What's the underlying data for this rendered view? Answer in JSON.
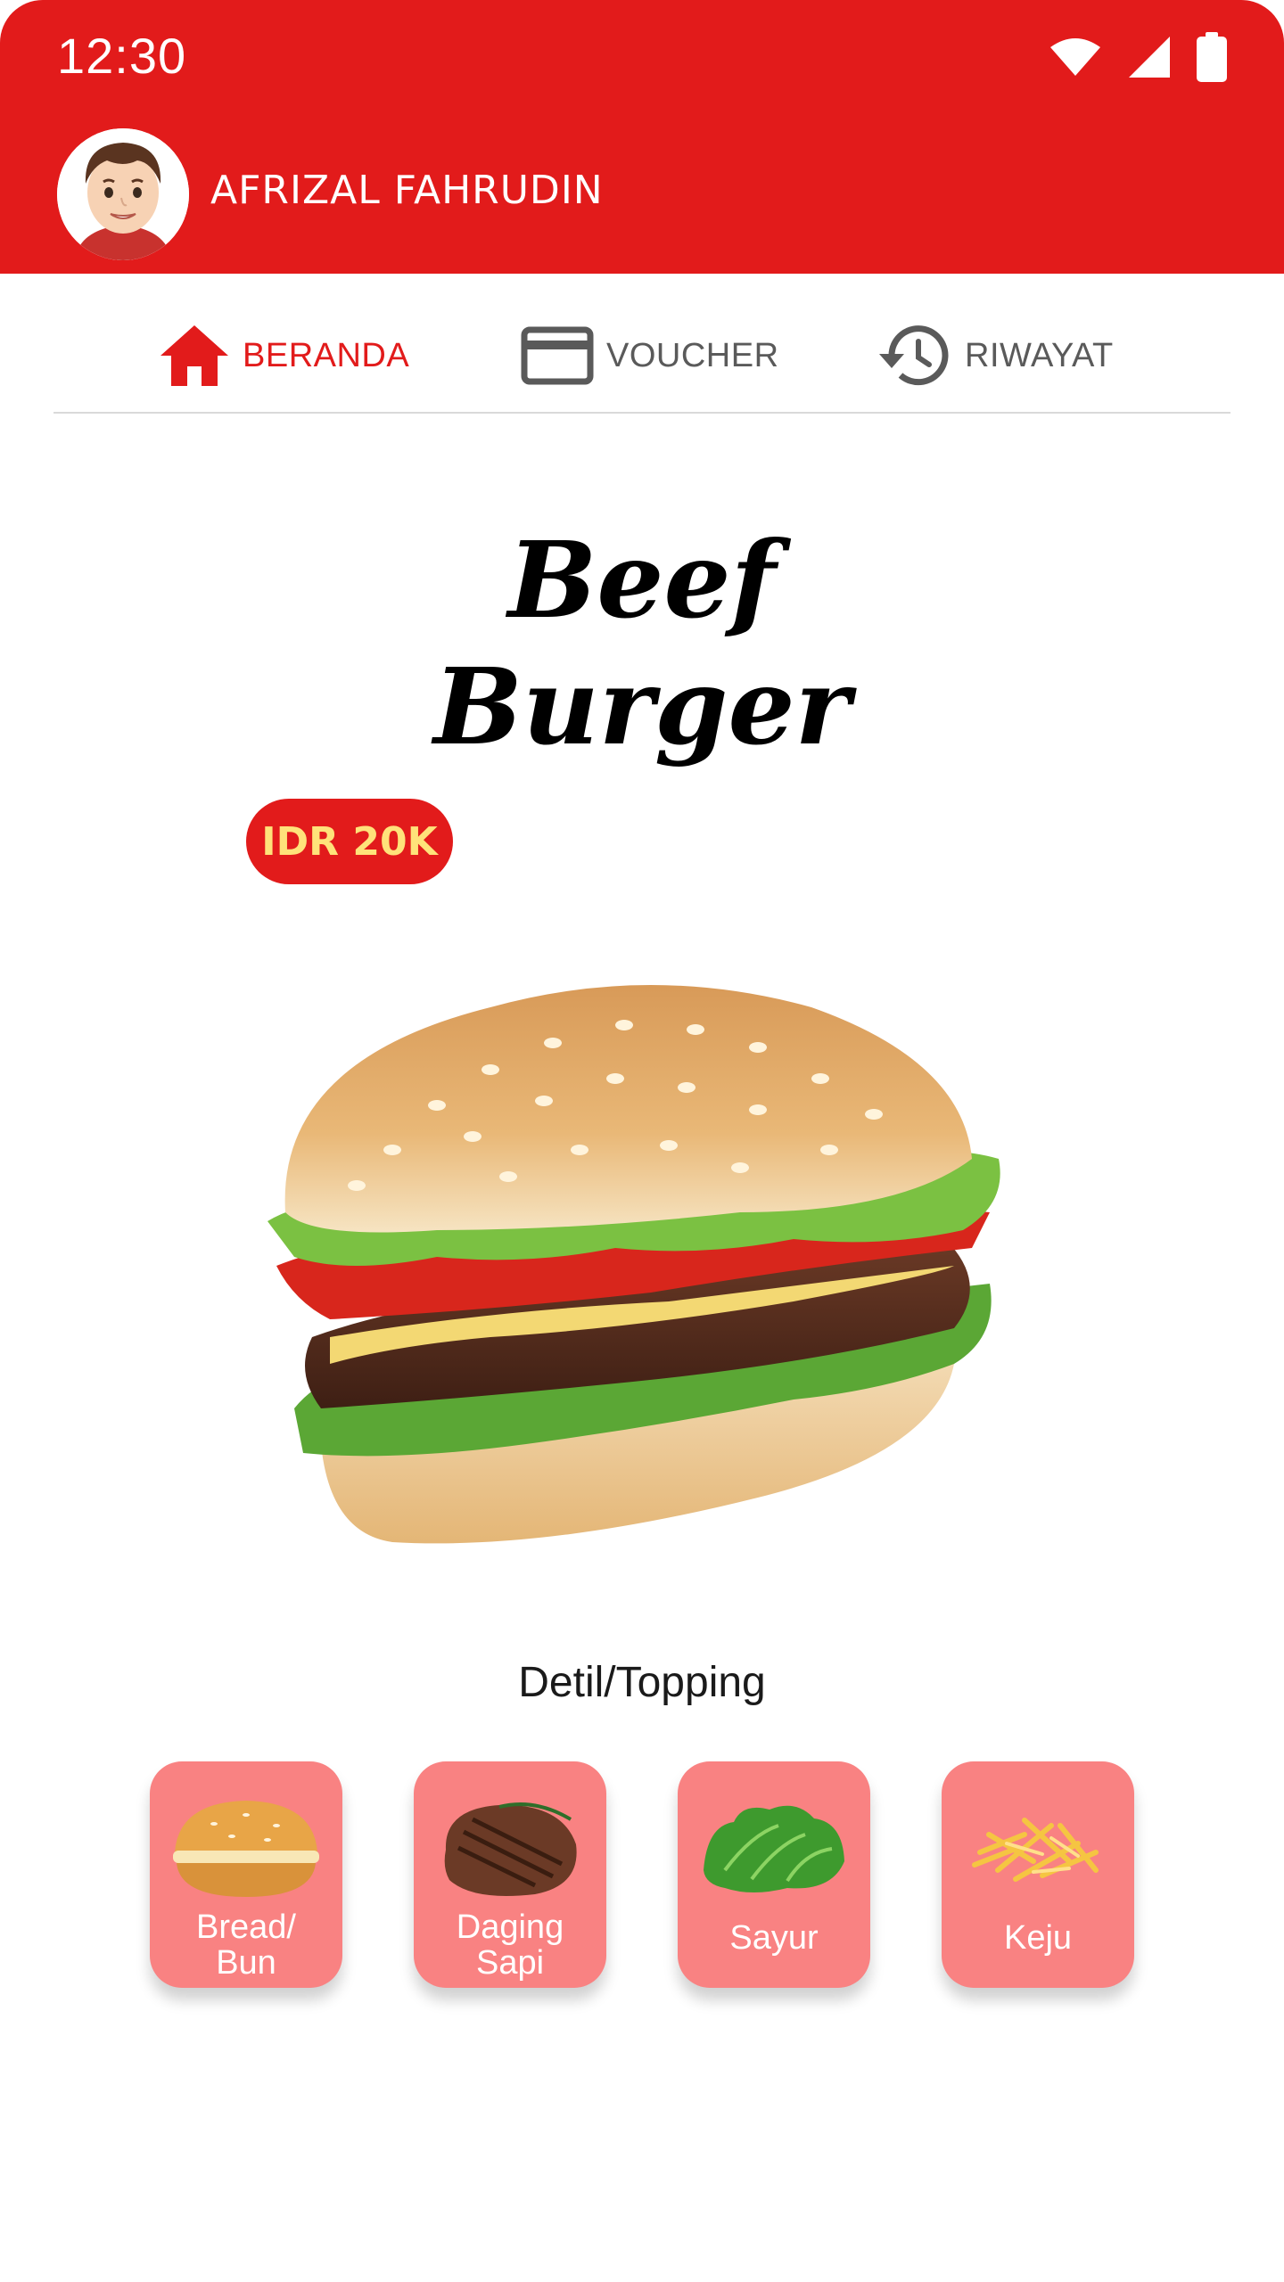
{
  "status_bar": {
    "time": "12:30"
  },
  "user": {
    "name": "AFRIZAL FAHRUDIN"
  },
  "tabs": [
    {
      "label": "BERANDA",
      "icon": "home-icon",
      "active": true
    },
    {
      "label": "VOUCHER",
      "icon": "credit-card-icon",
      "active": false
    },
    {
      "label": "RIWAYAT",
      "icon": "history-icon",
      "active": false
    }
  ],
  "product": {
    "title_line1": "Beef",
    "title_line2": "Burger",
    "price": "IDR 20K"
  },
  "detail_section": {
    "label": "Detil/Topping"
  },
  "toppings": [
    {
      "label_line1": "Bread/",
      "label_line2": "Bun",
      "icon": "bun-icon"
    },
    {
      "label_line1": "Daging",
      "label_line2": "Sapi",
      "icon": "steak-icon"
    },
    {
      "label_line1": "Sayur",
      "label_line2": "",
      "icon": "lettuce-icon"
    },
    {
      "label_line1": "Keju",
      "label_line2": "",
      "icon": "cheese-icon"
    }
  ],
  "colors": {
    "primary": "#E21B1B",
    "topping_card": "#F98282",
    "price_text": "#FFE27A"
  }
}
